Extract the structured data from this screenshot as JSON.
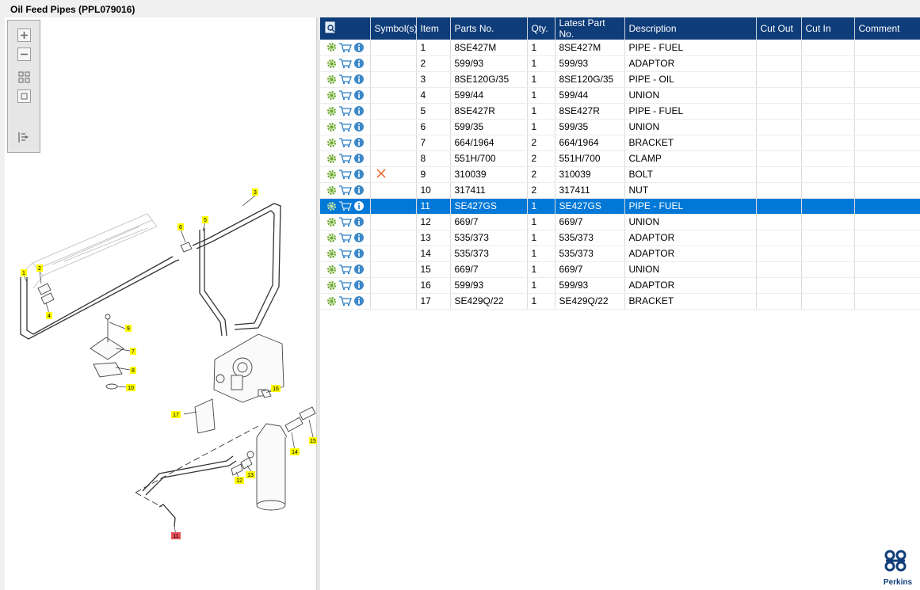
{
  "window": {
    "title": "Oil Feed Pipes (PPL079016)"
  },
  "table": {
    "headers": [
      "",
      "Symbol(s)",
      "Item",
      "Parts No.",
      "Qty.",
      "Latest Part No.",
      "Description",
      "Cut Out",
      "Cut In",
      "Comment"
    ],
    "rows": [
      {
        "symbol": "",
        "item": "1",
        "part": "8SE427M",
        "qty": "1",
        "latest": "8SE427M",
        "desc": "PIPE - FUEL",
        "cut_out": "",
        "cut_in": "",
        "comment": ""
      },
      {
        "symbol": "",
        "item": "2",
        "part": "599/93",
        "qty": "1",
        "latest": "599/93",
        "desc": "ADAPTOR",
        "cut_out": "",
        "cut_in": "",
        "comment": ""
      },
      {
        "symbol": "",
        "item": "3",
        "part": "8SE120G/35",
        "qty": "1",
        "latest": "8SE120G/35",
        "desc": "PIPE - OIL",
        "cut_out": "",
        "cut_in": "",
        "comment": ""
      },
      {
        "symbol": "",
        "item": "4",
        "part": "599/44",
        "qty": "1",
        "latest": "599/44",
        "desc": "UNION",
        "cut_out": "",
        "cut_in": "",
        "comment": ""
      },
      {
        "symbol": "",
        "item": "5",
        "part": "8SE427R",
        "qty": "1",
        "latest": "8SE427R",
        "desc": "PIPE - FUEL",
        "cut_out": "",
        "cut_in": "",
        "comment": ""
      },
      {
        "symbol": "",
        "item": "6",
        "part": "599/35",
        "qty": "1",
        "latest": "599/35",
        "desc": "UNION",
        "cut_out": "",
        "cut_in": "",
        "comment": ""
      },
      {
        "symbol": "",
        "item": "7",
        "part": "664/1964",
        "qty": "2",
        "latest": "664/1964",
        "desc": "BRACKET",
        "cut_out": "",
        "cut_in": "",
        "comment": ""
      },
      {
        "symbol": "",
        "item": "8",
        "part": "551H/700",
        "qty": "2",
        "latest": "551H/700",
        "desc": "CLAMP",
        "cut_out": "",
        "cut_in": "",
        "comment": ""
      },
      {
        "symbol": "cross",
        "item": "9",
        "part": "310039",
        "qty": "2",
        "latest": "310039",
        "desc": "BOLT",
        "cut_out": "",
        "cut_in": "",
        "comment": ""
      },
      {
        "symbol": "",
        "item": "10",
        "part": "317411",
        "qty": "2",
        "latest": "317411",
        "desc": "NUT",
        "cut_out": "",
        "cut_in": "",
        "comment": ""
      },
      {
        "symbol": "",
        "item": "11",
        "part": "SE427GS",
        "qty": "1",
        "latest": "SE427GS",
        "desc": "PIPE - FUEL",
        "cut_out": "",
        "cut_in": "",
        "comment": "",
        "selected": true
      },
      {
        "symbol": "",
        "item": "12",
        "part": "669/7",
        "qty": "1",
        "latest": "669/7",
        "desc": "UNION",
        "cut_out": "",
        "cut_in": "",
        "comment": ""
      },
      {
        "symbol": "",
        "item": "13",
        "part": "535/373",
        "qty": "1",
        "latest": "535/373",
        "desc": "ADAPTOR",
        "cut_out": "",
        "cut_in": "",
        "comment": ""
      },
      {
        "symbol": "",
        "item": "14",
        "part": "535/373",
        "qty": "1",
        "latest": "535/373",
        "desc": "ADAPTOR",
        "cut_out": "",
        "cut_in": "",
        "comment": ""
      },
      {
        "symbol": "",
        "item": "15",
        "part": "669/7",
        "qty": "1",
        "latest": "669/7",
        "desc": "UNION",
        "cut_out": "",
        "cut_in": "",
        "comment": ""
      },
      {
        "symbol": "",
        "item": "16",
        "part": "599/93",
        "qty": "1",
        "latest": "599/93",
        "desc": "ADAPTOR",
        "cut_out": "",
        "cut_in": "",
        "comment": ""
      },
      {
        "symbol": "",
        "item": "17",
        "part": "SE429Q/22",
        "qty": "1",
        "latest": "SE429Q/22",
        "desc": "BRACKET",
        "cut_out": "",
        "cut_in": "",
        "comment": ""
      }
    ]
  },
  "diagram": {
    "callouts": [
      "1",
      "2",
      "3",
      "4",
      "5",
      "6",
      "7",
      "8",
      "9",
      "10",
      "11",
      "12",
      "13",
      "14",
      "15",
      "16",
      "17"
    ],
    "highlighted_callout": "11"
  },
  "colors": {
    "header_bg": "#0f3d7a",
    "selected_row": "#0078d7",
    "callout": "#ffff00",
    "callout_highlight": "#e8505b",
    "cross": "#e85a1a"
  },
  "toolbar": {
    "icons": [
      "zoom-in-icon",
      "zoom-out-icon",
      "fit-all-icon",
      "fit-window-icon",
      "export-icon"
    ]
  },
  "brand": {
    "name": "Perkins"
  }
}
